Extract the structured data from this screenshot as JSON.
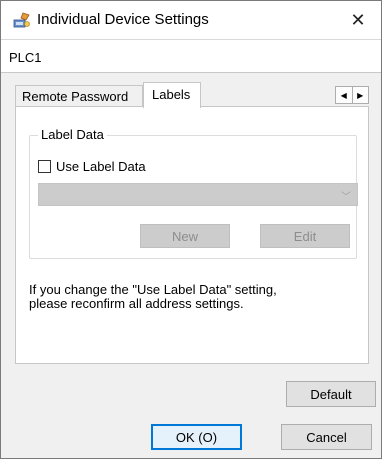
{
  "window": {
    "title": "Individual Device Settings",
    "close_glyph": "✕"
  },
  "device": {
    "name": "PLC1"
  },
  "tabs": [
    {
      "label": "Remote Password",
      "selected": false
    },
    {
      "label": "Labels",
      "selected": true
    }
  ],
  "tab_scroll": {
    "left_glyph": "◀",
    "right_glyph": "▶"
  },
  "label_data": {
    "group_label": "Label Data",
    "use_label_data_label": "Use Label Data",
    "use_label_data_checked": false,
    "combo_value": "",
    "combo_arrow_glyph": "﹀",
    "new_label": "New",
    "edit_label": "Edit"
  },
  "note_text": "If you change the \"Use Label Data\" setting,\nplease reconfirm all address settings.",
  "buttons": {
    "default_label": "Default",
    "ok_label": "OK (O)",
    "cancel_label": "Cancel"
  },
  "colors": {
    "accent_focus": "#0078d7",
    "disabled_fill": "#cccccc"
  },
  "icons": {
    "app": "settings-device-icon",
    "close": "close-icon"
  }
}
